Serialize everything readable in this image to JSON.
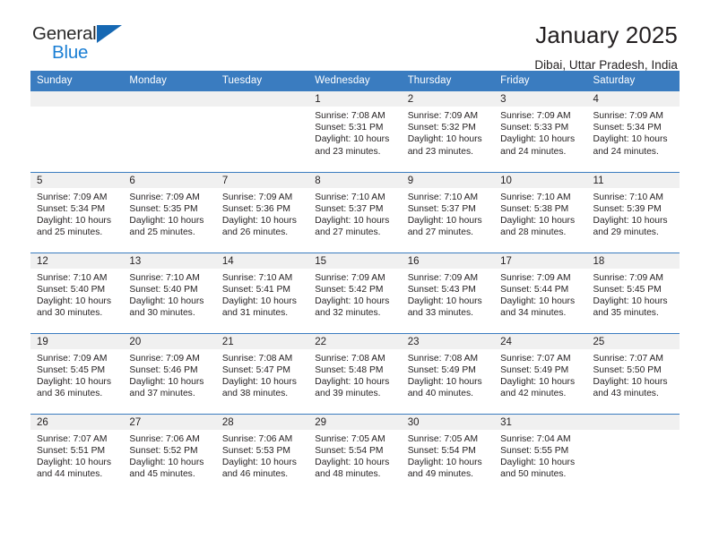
{
  "brand": {
    "word_one": "General",
    "word_two": "Blue",
    "logo_icon": "triangle-logo-icon"
  },
  "header": {
    "title": "January 2025",
    "subtitle": "Dibai, Uttar Pradesh, India"
  },
  "colors": {
    "header_blue": "#3a7cc0",
    "brand_blue": "#1b7fd4",
    "strip_gray": "#f0f0f0",
    "text": "#231f20"
  },
  "weekday_headers": [
    "Sunday",
    "Monday",
    "Tuesday",
    "Wednesday",
    "Thursday",
    "Friday",
    "Saturday"
  ],
  "weeks": [
    [
      {
        "day": "",
        "sunrise": "",
        "sunset": "",
        "daylight_line1": "",
        "daylight_line2": ""
      },
      {
        "day": "",
        "sunrise": "",
        "sunset": "",
        "daylight_line1": "",
        "daylight_line2": ""
      },
      {
        "day": "",
        "sunrise": "",
        "sunset": "",
        "daylight_line1": "",
        "daylight_line2": ""
      },
      {
        "day": "1",
        "sunrise": "Sunrise: 7:08 AM",
        "sunset": "Sunset: 5:31 PM",
        "daylight_line1": "Daylight: 10 hours",
        "daylight_line2": "and 23 minutes."
      },
      {
        "day": "2",
        "sunrise": "Sunrise: 7:09 AM",
        "sunset": "Sunset: 5:32 PM",
        "daylight_line1": "Daylight: 10 hours",
        "daylight_line2": "and 23 minutes."
      },
      {
        "day": "3",
        "sunrise": "Sunrise: 7:09 AM",
        "sunset": "Sunset: 5:33 PM",
        "daylight_line1": "Daylight: 10 hours",
        "daylight_line2": "and 24 minutes."
      },
      {
        "day": "4",
        "sunrise": "Sunrise: 7:09 AM",
        "sunset": "Sunset: 5:34 PM",
        "daylight_line1": "Daylight: 10 hours",
        "daylight_line2": "and 24 minutes."
      }
    ],
    [
      {
        "day": "5",
        "sunrise": "Sunrise: 7:09 AM",
        "sunset": "Sunset: 5:34 PM",
        "daylight_line1": "Daylight: 10 hours",
        "daylight_line2": "and 25 minutes."
      },
      {
        "day": "6",
        "sunrise": "Sunrise: 7:09 AM",
        "sunset": "Sunset: 5:35 PM",
        "daylight_line1": "Daylight: 10 hours",
        "daylight_line2": "and 25 minutes."
      },
      {
        "day": "7",
        "sunrise": "Sunrise: 7:09 AM",
        "sunset": "Sunset: 5:36 PM",
        "daylight_line1": "Daylight: 10 hours",
        "daylight_line2": "and 26 minutes."
      },
      {
        "day": "8",
        "sunrise": "Sunrise: 7:10 AM",
        "sunset": "Sunset: 5:37 PM",
        "daylight_line1": "Daylight: 10 hours",
        "daylight_line2": "and 27 minutes."
      },
      {
        "day": "9",
        "sunrise": "Sunrise: 7:10 AM",
        "sunset": "Sunset: 5:37 PM",
        "daylight_line1": "Daylight: 10 hours",
        "daylight_line2": "and 27 minutes."
      },
      {
        "day": "10",
        "sunrise": "Sunrise: 7:10 AM",
        "sunset": "Sunset: 5:38 PM",
        "daylight_line1": "Daylight: 10 hours",
        "daylight_line2": "and 28 minutes."
      },
      {
        "day": "11",
        "sunrise": "Sunrise: 7:10 AM",
        "sunset": "Sunset: 5:39 PM",
        "daylight_line1": "Daylight: 10 hours",
        "daylight_line2": "and 29 minutes."
      }
    ],
    [
      {
        "day": "12",
        "sunrise": "Sunrise: 7:10 AM",
        "sunset": "Sunset: 5:40 PM",
        "daylight_line1": "Daylight: 10 hours",
        "daylight_line2": "and 30 minutes."
      },
      {
        "day": "13",
        "sunrise": "Sunrise: 7:10 AM",
        "sunset": "Sunset: 5:40 PM",
        "daylight_line1": "Daylight: 10 hours",
        "daylight_line2": "and 30 minutes."
      },
      {
        "day": "14",
        "sunrise": "Sunrise: 7:10 AM",
        "sunset": "Sunset: 5:41 PM",
        "daylight_line1": "Daylight: 10 hours",
        "daylight_line2": "and 31 minutes."
      },
      {
        "day": "15",
        "sunrise": "Sunrise: 7:09 AM",
        "sunset": "Sunset: 5:42 PM",
        "daylight_line1": "Daylight: 10 hours",
        "daylight_line2": "and 32 minutes."
      },
      {
        "day": "16",
        "sunrise": "Sunrise: 7:09 AM",
        "sunset": "Sunset: 5:43 PM",
        "daylight_line1": "Daylight: 10 hours",
        "daylight_line2": "and 33 minutes."
      },
      {
        "day": "17",
        "sunrise": "Sunrise: 7:09 AM",
        "sunset": "Sunset: 5:44 PM",
        "daylight_line1": "Daylight: 10 hours",
        "daylight_line2": "and 34 minutes."
      },
      {
        "day": "18",
        "sunrise": "Sunrise: 7:09 AM",
        "sunset": "Sunset: 5:45 PM",
        "daylight_line1": "Daylight: 10 hours",
        "daylight_line2": "and 35 minutes."
      }
    ],
    [
      {
        "day": "19",
        "sunrise": "Sunrise: 7:09 AM",
        "sunset": "Sunset: 5:45 PM",
        "daylight_line1": "Daylight: 10 hours",
        "daylight_line2": "and 36 minutes."
      },
      {
        "day": "20",
        "sunrise": "Sunrise: 7:09 AM",
        "sunset": "Sunset: 5:46 PM",
        "daylight_line1": "Daylight: 10 hours",
        "daylight_line2": "and 37 minutes."
      },
      {
        "day": "21",
        "sunrise": "Sunrise: 7:08 AM",
        "sunset": "Sunset: 5:47 PM",
        "daylight_line1": "Daylight: 10 hours",
        "daylight_line2": "and 38 minutes."
      },
      {
        "day": "22",
        "sunrise": "Sunrise: 7:08 AM",
        "sunset": "Sunset: 5:48 PM",
        "daylight_line1": "Daylight: 10 hours",
        "daylight_line2": "and 39 minutes."
      },
      {
        "day": "23",
        "sunrise": "Sunrise: 7:08 AM",
        "sunset": "Sunset: 5:49 PM",
        "daylight_line1": "Daylight: 10 hours",
        "daylight_line2": "and 40 minutes."
      },
      {
        "day": "24",
        "sunrise": "Sunrise: 7:07 AM",
        "sunset": "Sunset: 5:49 PM",
        "daylight_line1": "Daylight: 10 hours",
        "daylight_line2": "and 42 minutes."
      },
      {
        "day": "25",
        "sunrise": "Sunrise: 7:07 AM",
        "sunset": "Sunset: 5:50 PM",
        "daylight_line1": "Daylight: 10 hours",
        "daylight_line2": "and 43 minutes."
      }
    ],
    [
      {
        "day": "26",
        "sunrise": "Sunrise: 7:07 AM",
        "sunset": "Sunset: 5:51 PM",
        "daylight_line1": "Daylight: 10 hours",
        "daylight_line2": "and 44 minutes."
      },
      {
        "day": "27",
        "sunrise": "Sunrise: 7:06 AM",
        "sunset": "Sunset: 5:52 PM",
        "daylight_line1": "Daylight: 10 hours",
        "daylight_line2": "and 45 minutes."
      },
      {
        "day": "28",
        "sunrise": "Sunrise: 7:06 AM",
        "sunset": "Sunset: 5:53 PM",
        "daylight_line1": "Daylight: 10 hours",
        "daylight_line2": "and 46 minutes."
      },
      {
        "day": "29",
        "sunrise": "Sunrise: 7:05 AM",
        "sunset": "Sunset: 5:54 PM",
        "daylight_line1": "Daylight: 10 hours",
        "daylight_line2": "and 48 minutes."
      },
      {
        "day": "30",
        "sunrise": "Sunrise: 7:05 AM",
        "sunset": "Sunset: 5:54 PM",
        "daylight_line1": "Daylight: 10 hours",
        "daylight_line2": "and 49 minutes."
      },
      {
        "day": "31",
        "sunrise": "Sunrise: 7:04 AM",
        "sunset": "Sunset: 5:55 PM",
        "daylight_line1": "Daylight: 10 hours",
        "daylight_line2": "and 50 minutes."
      },
      {
        "day": "",
        "sunrise": "",
        "sunset": "",
        "daylight_line1": "",
        "daylight_line2": ""
      }
    ]
  ]
}
